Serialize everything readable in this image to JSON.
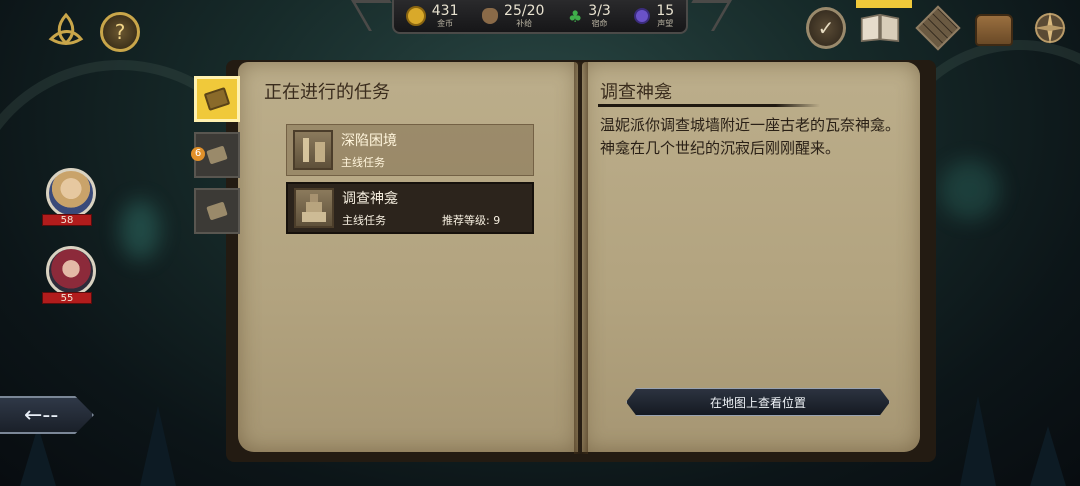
{
  "resources": [
    {
      "icon": "gold-coin-icon",
      "value": "431",
      "label": "金币",
      "color": "#d9a92a"
    },
    {
      "icon": "supply-sack-icon",
      "value": "25/20",
      "label": "补给",
      "color": "#8a6a48"
    },
    {
      "icon": "clover-icon",
      "value": "3/3",
      "label": "宿命",
      "color": "#3fae4a"
    },
    {
      "icon": "reputation-gem-icon",
      "value": "15",
      "label": "声望",
      "color": "#6a52c8"
    }
  ],
  "top_left": {
    "help_glyph": "?"
  },
  "top_right": {
    "confirm_glyph": "✓"
  },
  "party": [
    {
      "hp": "58",
      "portrait_color": "#c9a36a"
    },
    {
      "hp": "55",
      "portrait_color": "#8c2a3a"
    }
  ],
  "side_tabs": {
    "badge_count": "6"
  },
  "left_page": {
    "heading": "正在进行的任务",
    "quests": [
      {
        "title": "深陷困境",
        "type": "主线任务",
        "level": ""
      },
      {
        "title": "调查神龛",
        "type": "主线任务",
        "level": "推荐等级: 9"
      }
    ]
  },
  "right_page": {
    "heading": "调查神龛",
    "description": "温妮派你调查城墙附近一座古老的瓦奈神龛。神龛在几个世纪的沉寂后刚刚醒来。",
    "map_button": "在地图上查看位置"
  },
  "back_button": {
    "glyph": "←--"
  },
  "colors": {
    "accent_gold": "#f0c93a",
    "hp_red": "#b11c1c",
    "parchment": "#b8aa86"
  }
}
